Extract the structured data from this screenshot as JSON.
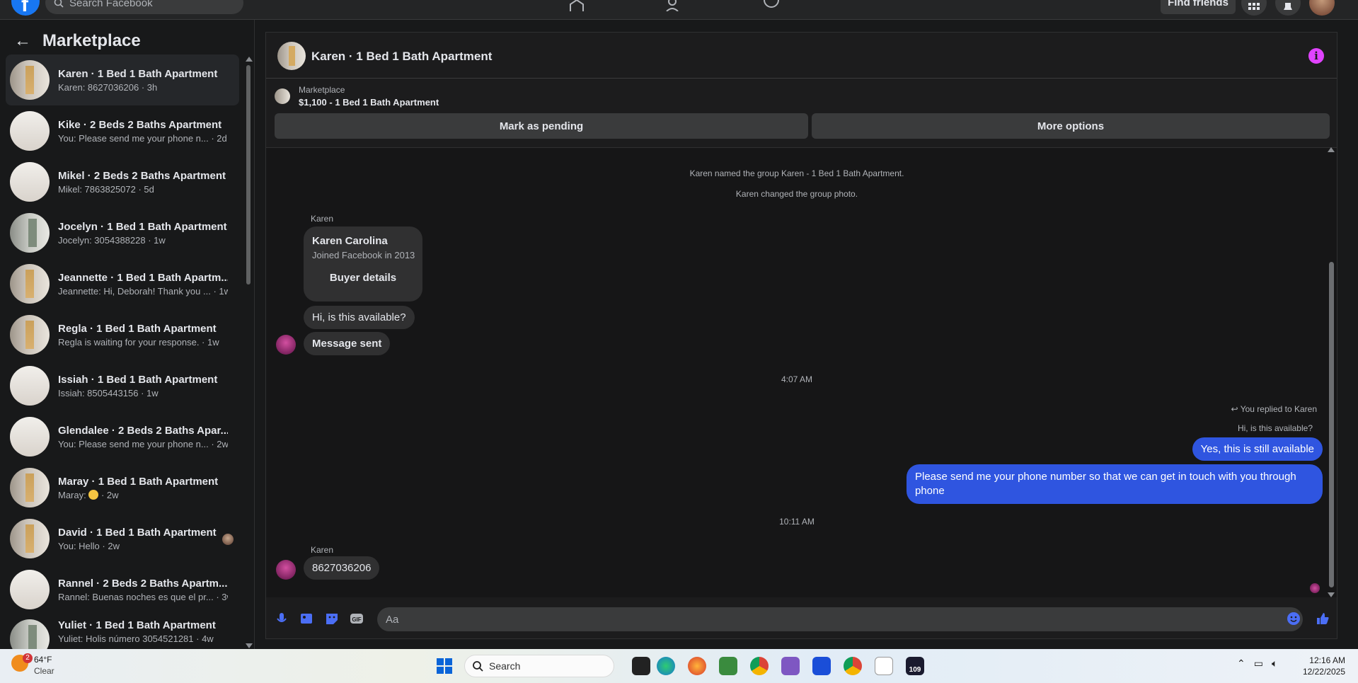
{
  "topbar": {
    "search_placeholder": "Search Facebook",
    "find_friends_label": "Find friends"
  },
  "sidebar": {
    "back_icon": "arrow-left-icon",
    "title": "Marketplace",
    "items": [
      {
        "title": "Karen · 1 Bed 1 Bath Apartment",
        "sub": "Karen: 8627036206 · 3h"
      },
      {
        "title": "Kike · 2 Beds 2 Baths Apartment",
        "sub": "You: Please send me your phone n... · 2d"
      },
      {
        "title": "Mikel · 2 Beds 2 Baths Apartment",
        "sub": "Mikel: 7863825072 · 5d"
      },
      {
        "title": "Jocelyn · 1 Bed 1 Bath Apartment",
        "sub": "Jocelyn: 3054388228 · 1w"
      },
      {
        "title": "Jeannette · 1 Bed 1 Bath Apartm...",
        "sub": "Jeannette: Hi, Deborah! Thank you ... · 1w"
      },
      {
        "title": "Regla · 1 Bed 1 Bath Apartment",
        "sub": "Regla is waiting for your response. · 1w"
      },
      {
        "title": "Issiah · 1 Bed 1 Bath Apartment",
        "sub": "Issiah: 8505443156 · 1w"
      },
      {
        "title": "Glendalee · 2 Beds 2 Baths Apar...",
        "sub": "You: Please send me your phone n... · 2w"
      },
      {
        "title": "Maray · 1 Bed 1 Bath Apartment",
        "sub_prefix": "Maray: ",
        "sub_suffix": " · 2w"
      },
      {
        "title": "David · 1 Bed 1 Bath Apartment",
        "sub": "You: Hello · 2w"
      },
      {
        "title": "Rannel · 2 Beds 2 Baths Apartm...",
        "sub": "Rannel: Buenas noches es que el pr... · 3w"
      },
      {
        "title": "Yuliet · 1 Bed 1 Bath Apartment",
        "sub": "Yuliet: Holis número 3054521281 · 4w"
      }
    ]
  },
  "chat": {
    "title": "Karen · 1 Bed 1 Bath Apartment",
    "listing_label": "Marketplace",
    "listing_title": "$1,100 - 1 Bed 1 Bath Apartment",
    "mark_pending": "Mark as pending",
    "more_options": "More options",
    "sys1": "Karen named the group Karen - 1 Bed 1 Bath Apartment.",
    "sys2": "Karen changed the group photo.",
    "sender1": "Karen",
    "card_name": "Karen Carolina",
    "card_sub": "Joined Facebook in 2013",
    "card_button": "Buyer details",
    "msg1": "Hi, is this available?",
    "msg2": "Message sent",
    "time1": "4:07 AM",
    "reply_note": "You replied to Karen",
    "reply_quote": "Hi, is this available?",
    "out1": "Yes, this is still available",
    "out2": "Please send me your phone  number so that we can get in touch with you through phone",
    "time2": "10:11 AM",
    "sender2": "Karen",
    "msg3": "8627036206",
    "composer_placeholder": "Aa"
  },
  "taskbar": {
    "temp": "64°F",
    "condition": "Clear",
    "weather_badge": "2",
    "search_label": "Search",
    "time": "12:16 AM",
    "date": "12/22/2025",
    "badge_109": "109"
  },
  "colors": {
    "accent_blue": "#2f55e0",
    "info_magenta": "#e043ff",
    "bg_dark": "#18191a"
  }
}
